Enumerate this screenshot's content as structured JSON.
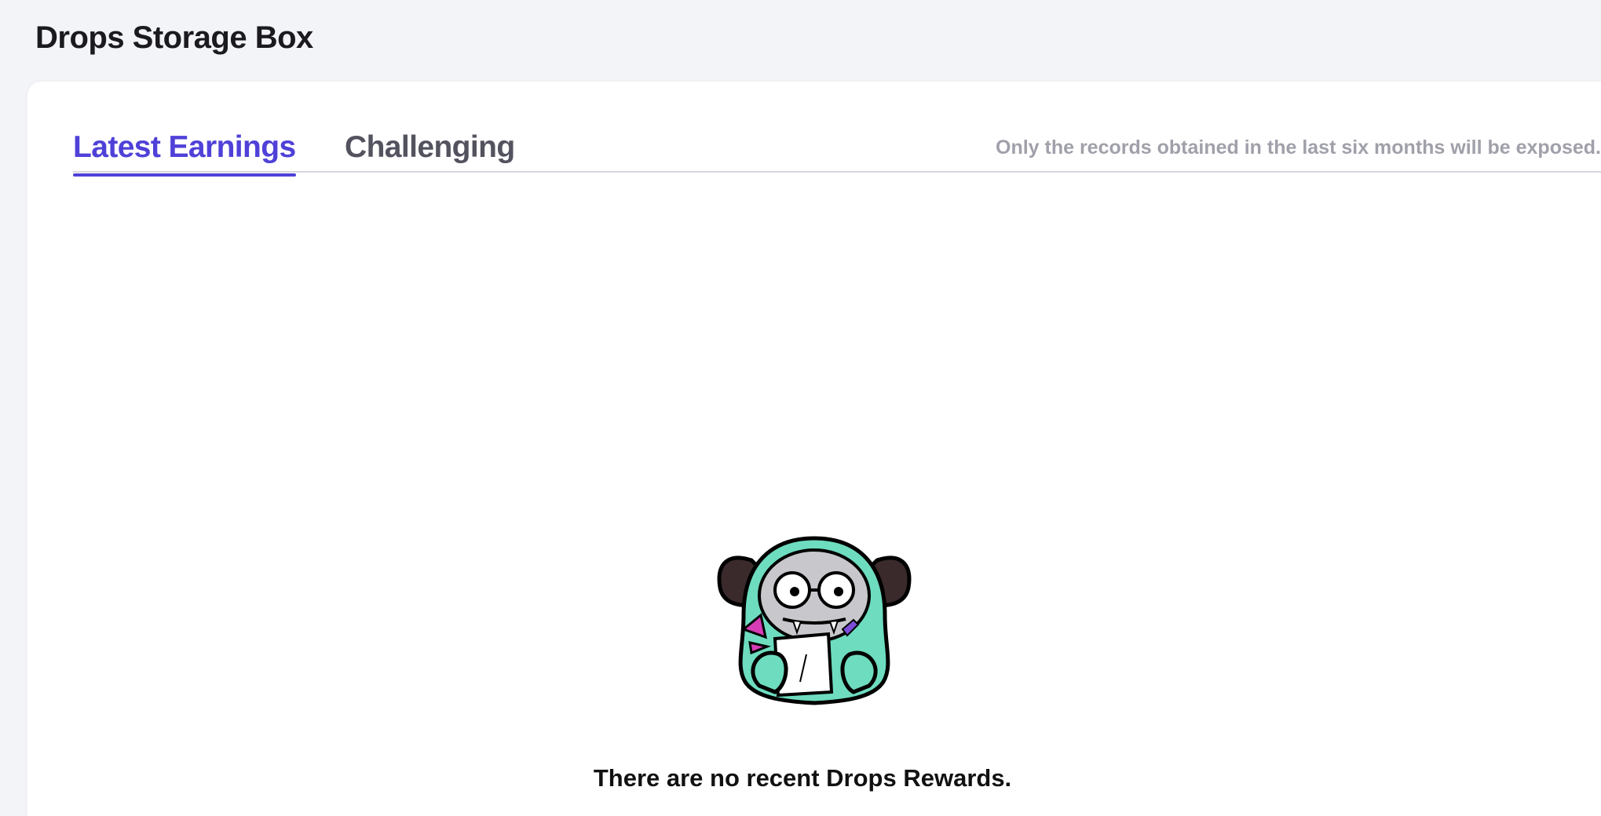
{
  "header": {
    "title": "Drops Storage Box"
  },
  "tabs": [
    {
      "label": "Latest Earnings",
      "active": true
    },
    {
      "label": "Challenging",
      "active": false
    }
  ],
  "notice": "Only the records obtained in the last six months will be exposed.",
  "empty_state": {
    "message": "There are no recent Drops Rewards.",
    "illustration": "mascot-writing-note-icon"
  },
  "colors": {
    "accent": "#4f41d8",
    "mascot_body": "#6edcbf",
    "mascot_horns": "#3a2a2c",
    "mascot_face": "#c8c8cc"
  }
}
